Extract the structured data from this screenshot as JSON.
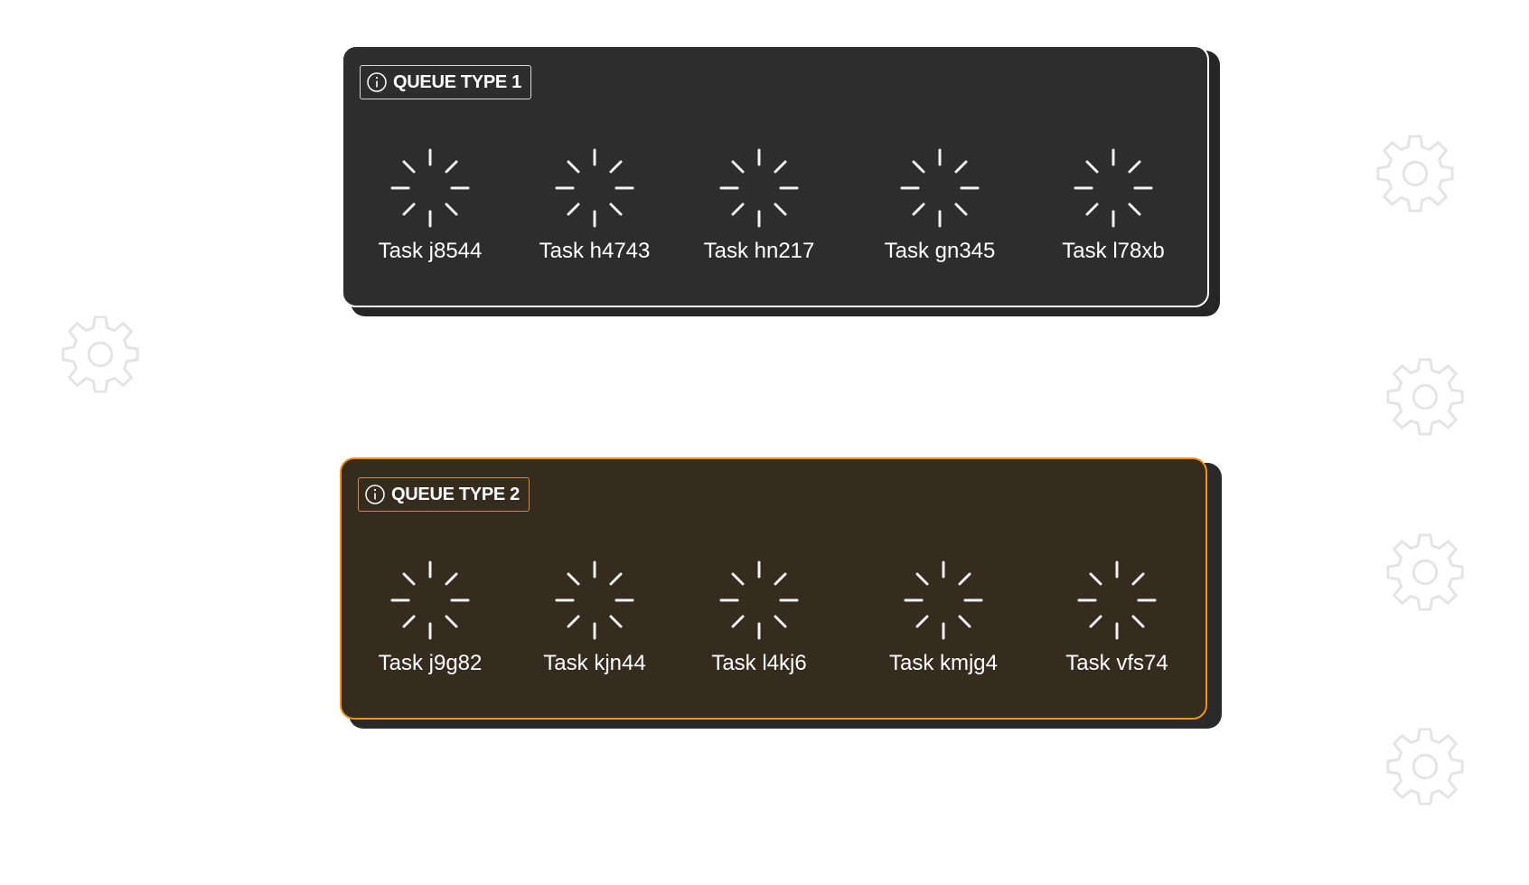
{
  "queues": [
    {
      "label": "QUEUE TYPE 1",
      "tasks": [
        "Task j8544",
        "Task h4743",
        "Task hn217",
        "Task gn345",
        "Task l78xb"
      ]
    },
    {
      "label": "QUEUE TYPE 2",
      "tasks": [
        "Task j9g82",
        "Task kjn44",
        "Task l4kj6",
        "Task kmjg4",
        "Task vfs74"
      ]
    }
  ],
  "colors": {
    "queue1_fill": "#2d2d2d",
    "queue1_border": "#ffffff",
    "queue2_fill": "#352b1e",
    "queue2_border": "#f0921e",
    "gear_stroke": "#e4e4e4"
  },
  "icons": [
    "info-icon",
    "loading-spinner-icon",
    "gear-icon"
  ]
}
